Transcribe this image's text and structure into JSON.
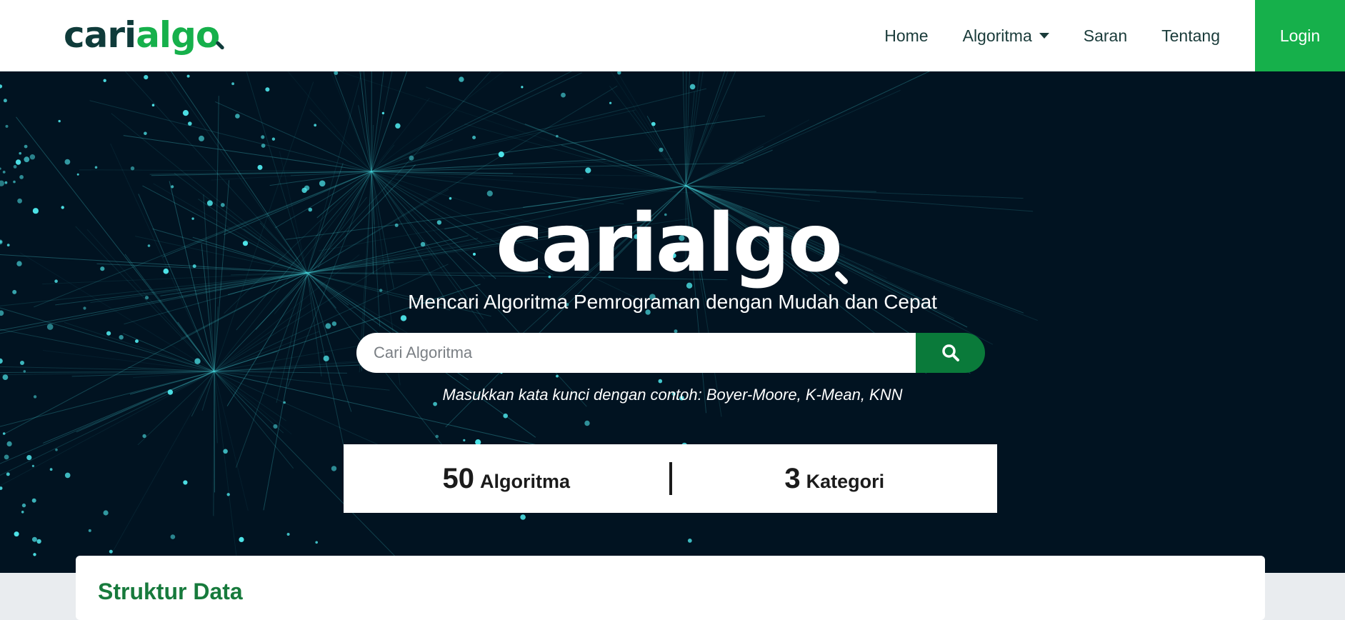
{
  "navbar": {
    "brand": {
      "part1": "cari",
      "part2": "algo"
    },
    "links": [
      {
        "label": "Home"
      },
      {
        "label": "Algoritma"
      },
      {
        "label": "Saran"
      },
      {
        "label": "Tentang"
      }
    ],
    "login_label": "Login"
  },
  "hero": {
    "logo_text": "carialgo",
    "tagline": "Mencari Algoritma Pemrograman dengan Mudah dan Cepat",
    "search": {
      "placeholder": "Cari Algoritma",
      "button_icon": "search-icon"
    },
    "hint": "Masukkan kata kunci dengan contoh: Boyer-Moore, K-Mean, KNN",
    "stats": [
      {
        "value": "50",
        "label": "Algoritma"
      },
      {
        "value": "3",
        "label": "Kategori"
      }
    ]
  },
  "section": {
    "title": "Struktur Data"
  },
  "colors": {
    "brand_green": "#16b04b",
    "dark_green": "#0a7a3a",
    "hero_bg": "#011321",
    "particle": "#4ee5ea"
  }
}
